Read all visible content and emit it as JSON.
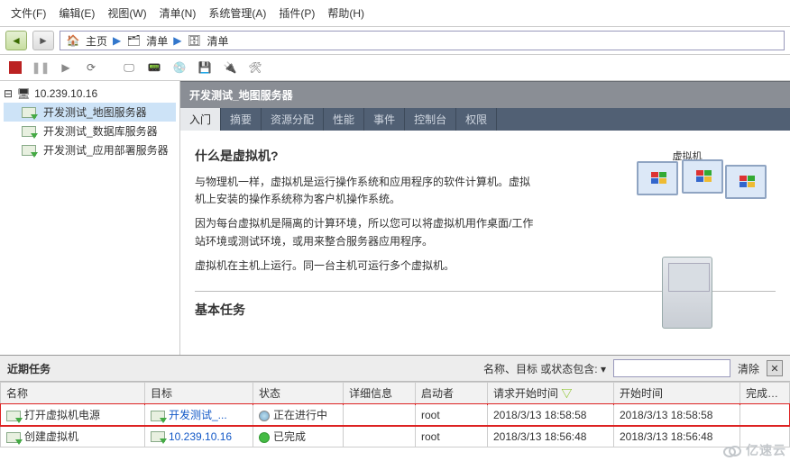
{
  "menu": {
    "items": [
      "文件(F)",
      "编辑(E)",
      "视图(W)",
      "清单(N)",
      "系统管理(A)",
      "插件(P)",
      "帮助(H)"
    ]
  },
  "addr": {
    "home": "主页",
    "inv1": "清单",
    "inv2": "清单"
  },
  "tree": {
    "root": "10.239.10.16",
    "nodes": [
      {
        "label": "开发测试_地图服务器",
        "sel": true
      },
      {
        "label": "开发测试_数据库服务器",
        "sel": false
      },
      {
        "label": "开发测试_应用部署服务器",
        "sel": false
      }
    ]
  },
  "content": {
    "title": "开发测试_地图服务器",
    "tabs": [
      "入门",
      "摘要",
      "资源分配",
      "性能",
      "事件",
      "控制台",
      "权限"
    ],
    "active_tab": 0,
    "h_whatvm": "什么是虚拟机?",
    "p1": "与物理机一样，虚拟机是运行操作系统和应用程序的软件计算机。虚拟机上安装的操作系统称为客户机操作系统。",
    "p2": "因为每台虚拟机是隔离的计算环境，所以您可以将虚拟机用作桌面/工作站环境或测试环境，或用来整合服务器应用程序。",
    "p3": "虚拟机在主机上运行。同一台主机可运行多个虚拟机。",
    "h_basic": "基本任务",
    "illus_label": "虚拟机"
  },
  "tasks": {
    "panel_title": "近期任务",
    "filter_label": "名称、目标 或状态包含: ▾",
    "clear_btn": "清除",
    "cols": [
      "名称",
      "目标",
      "状态",
      "详细信息",
      "启动者",
      "请求开始时间",
      "开始时间",
      "完成时间"
    ],
    "sort_col": 5,
    "rows": [
      {
        "name": "打开虚拟机电源",
        "target": "开发测试_...",
        "target_link": true,
        "status": "正在进行中",
        "status_kind": "run",
        "details": "",
        "initiator": "root",
        "req": "2018/3/13 18:58:58",
        "start": "2018/3/13 18:58:58",
        "end": "",
        "hl": true
      },
      {
        "name": "创建虚拟机",
        "target": "10.239.10.16",
        "target_link": true,
        "status": "已完成",
        "status_kind": "ok",
        "details": "",
        "initiator": "root",
        "req": "2018/3/13 18:56:48",
        "start": "2018/3/13 18:56:48",
        "end": "",
        "hl": false
      }
    ]
  },
  "watermark": "亿速云"
}
